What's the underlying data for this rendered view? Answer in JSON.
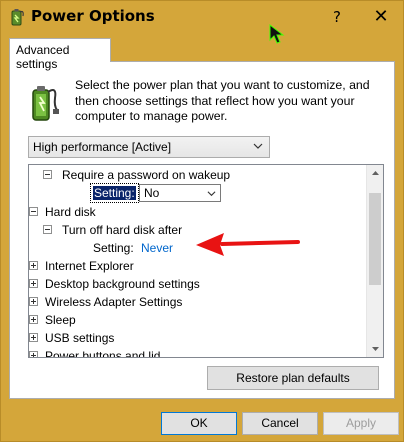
{
  "window": {
    "title": "Power Options",
    "help_label": "?",
    "close_label": "✕"
  },
  "tab": {
    "label": "Advanced settings"
  },
  "description": "Select the power plan that you want to customize, and then choose settings that reflect how you want your computer to manage power.",
  "plan_dropdown": {
    "selected": "High performance [Active]"
  },
  "tree": {
    "require_password": "Require a password on wakeup",
    "setting_label": "Setting:",
    "setting_value": "No",
    "hard_disk": "Hard disk",
    "turn_off_hard_disk": "Turn off hard disk after",
    "never_setting_label": "Setting:",
    "never_value": "Never",
    "items": [
      "Internet Explorer",
      "Desktop background settings",
      "Wireless Adapter Settings",
      "Sleep",
      "USB settings",
      "Power buttons and lid"
    ]
  },
  "buttons": {
    "restore": "Restore plan defaults",
    "ok": "OK",
    "cancel": "Cancel",
    "apply": "Apply"
  },
  "colors": {
    "titlebar": "#d4a63a",
    "link": "#0066cc",
    "arrow": "#e81313"
  }
}
